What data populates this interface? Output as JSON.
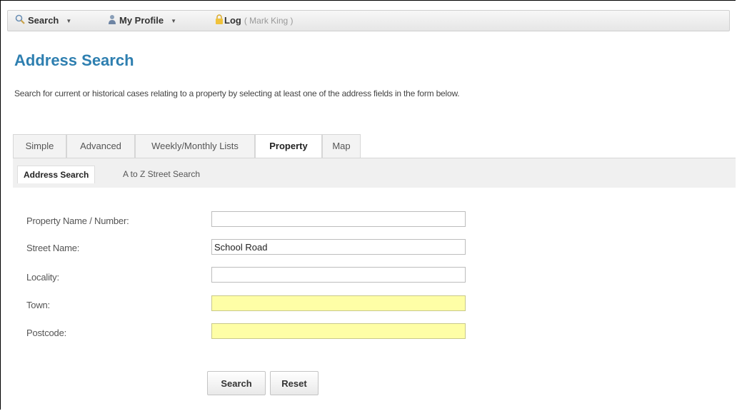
{
  "toolbar": {
    "search_label": "Search",
    "profile_label": "My Profile",
    "log_label": "Log",
    "user_name": "( Mark King )"
  },
  "page": {
    "title": "Address Search",
    "intro": "Search for current or historical cases relating to a property by selecting at least one of the address fields in the form below."
  },
  "tabs": [
    {
      "label": "Simple",
      "active": false
    },
    {
      "label": "Advanced",
      "active": false
    },
    {
      "label": "Weekly/Monthly Lists",
      "active": false
    },
    {
      "label": "Property",
      "active": true
    },
    {
      "label": "Map",
      "active": false
    }
  ],
  "subtabs": [
    {
      "label": "Address Search",
      "active": true
    },
    {
      "label": "A to Z Street Search",
      "active": false
    }
  ],
  "form": {
    "fields": [
      {
        "label": "Property Name / Number:",
        "value": "",
        "required": false
      },
      {
        "label": "Street Name:",
        "value": "School Road",
        "required": false
      },
      {
        "label": "Locality:",
        "value": "",
        "required": false
      },
      {
        "label": "Town:",
        "value": "",
        "required": true
      },
      {
        "label": "Postcode:",
        "value": "",
        "required": true
      }
    ],
    "search_label": "Search",
    "reset_label": "Reset"
  },
  "colors": {
    "title": "#2e7fb0",
    "required_field": "#fefea6"
  }
}
